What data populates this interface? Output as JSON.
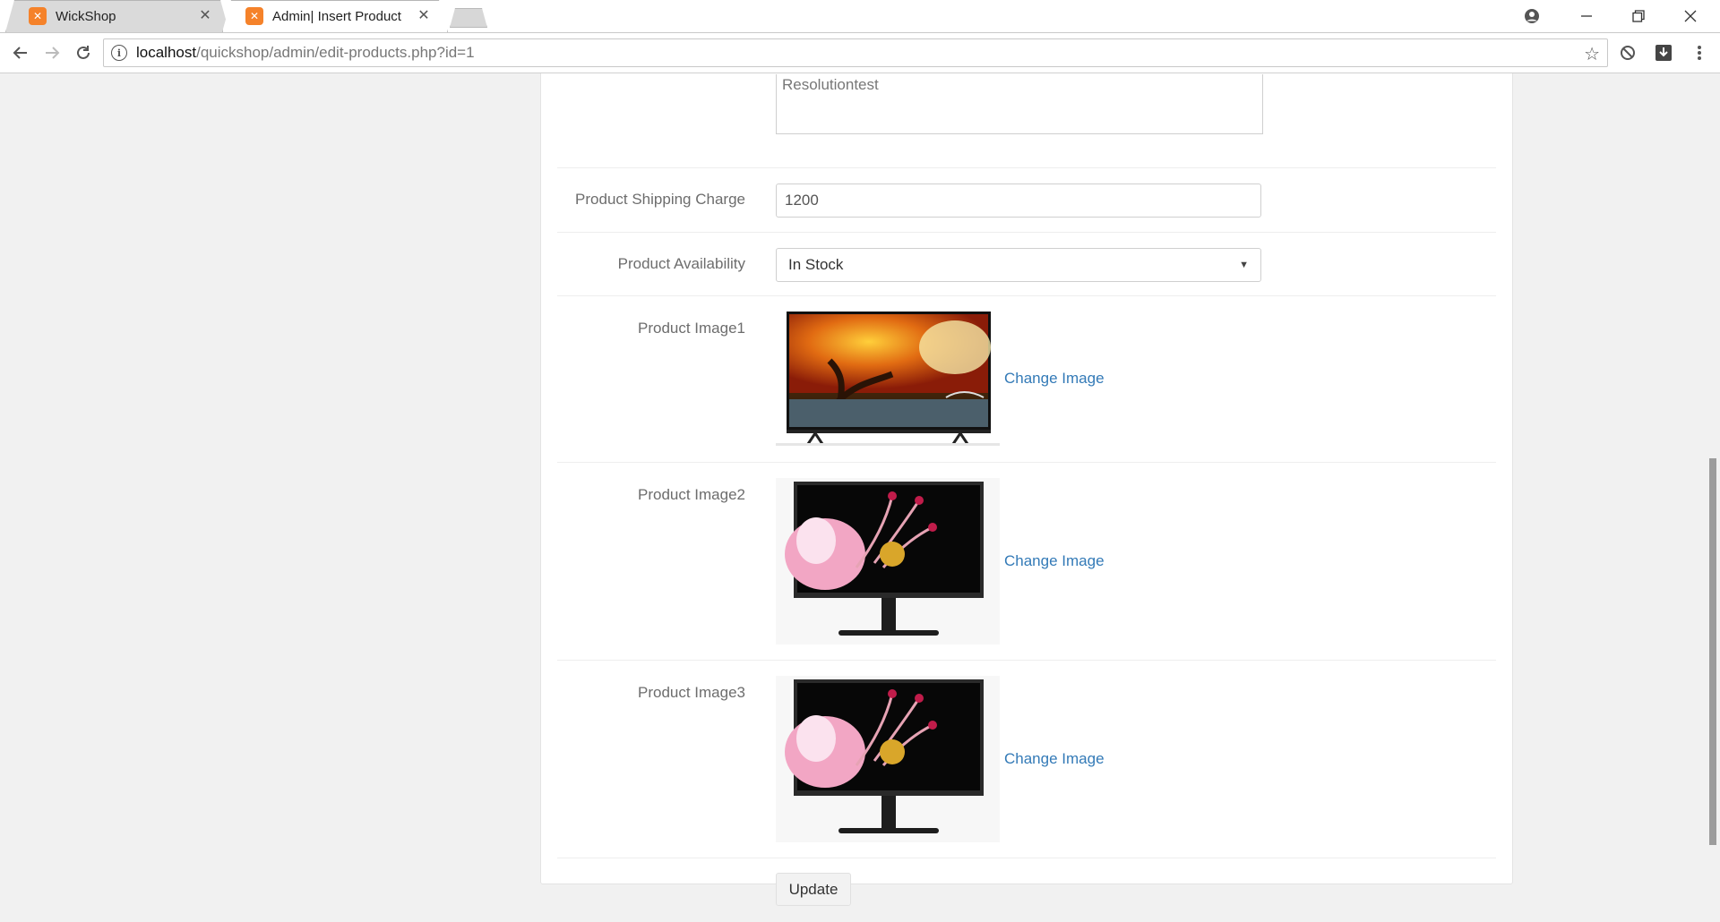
{
  "browser": {
    "tabs": [
      {
        "title": "WickShop",
        "active": false
      },
      {
        "title": "Admin| Insert Product",
        "active": true
      }
    ],
    "address": {
      "host": "localhost",
      "path": "/quickshop/admin/edit-products.php?id=1"
    }
  },
  "form": {
    "description_value": "Resolutiontest",
    "shipping": {
      "label": "Product Shipping Charge",
      "value": "1200"
    },
    "availability": {
      "label": "Product Availability",
      "selected": "In Stock"
    },
    "images": [
      {
        "label": "Product Image1",
        "link": "Change Image"
      },
      {
        "label": "Product Image2",
        "link": "Change Image"
      },
      {
        "label": "Product Image3",
        "link": "Change Image"
      }
    ],
    "submit_label": "Update"
  },
  "colors": {
    "link": "#337ab7",
    "favicon": "#f5822a",
    "page_bg": "#f1f1f1"
  }
}
